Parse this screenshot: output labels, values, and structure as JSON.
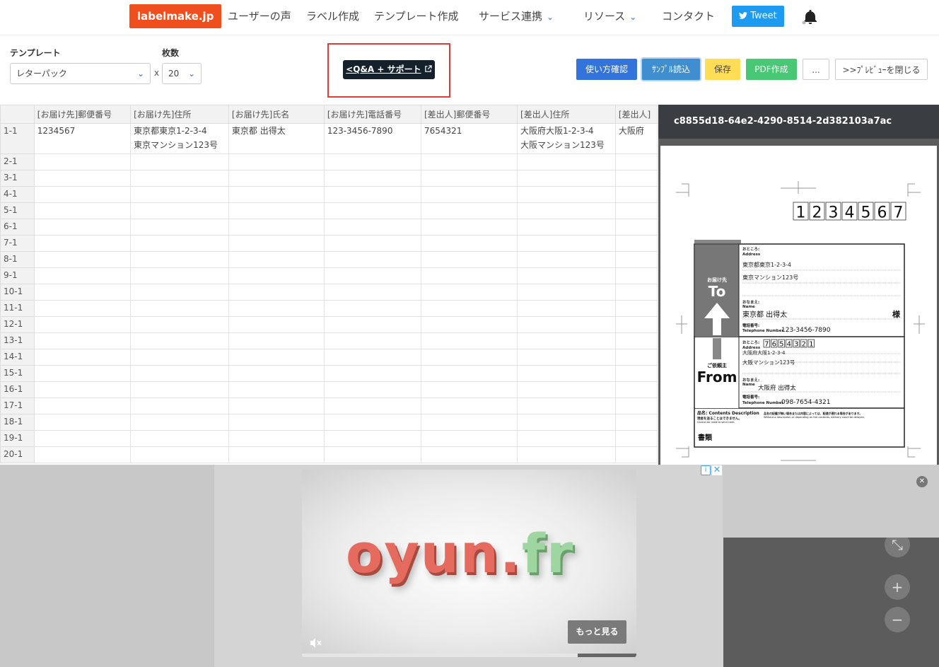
{
  "nav": {
    "logo": "labelmake.jp",
    "items": [
      "ユーザーの声",
      "ラベル作成",
      "テンプレート作成",
      "サービス連携",
      "リソース",
      "コンタクト"
    ],
    "tweet": "Tweet"
  },
  "toolbar": {
    "template_label": "テンプレート",
    "template_value": "レターパック",
    "count_label": "枚数",
    "count_value": "20",
    "x": "x",
    "qa_label": "<Q&A + サポート",
    "qa_end": ">",
    "buttons": {
      "howto": "使い方確認",
      "sample": "ｻﾝﾌﾟﾙ読込",
      "save": "保存",
      "pdf": "PDF作成",
      "more": "...",
      "close_preview": ">>ﾌﾟﾚﾋﾞｭｰを閉じる"
    },
    "colors": {
      "howto": "#3273dc",
      "sample": "#3e8ed0",
      "save": "#ffdd57",
      "pdf": "#48c774"
    }
  },
  "grid": {
    "headers": [
      "[お届け先]郵便番号",
      "[お届け先]住所",
      "[お届け先]氏名",
      "[お届け先]電話番号",
      "[差出人]郵便番号",
      "[差出人]住所",
      "[差出人]"
    ],
    "first_row": {
      "id": "1-1",
      "cells": [
        "1234567",
        "東京都東京1-2-3-4",
        "東京都 出得太",
        "123-3456-7890",
        "7654321",
        "大阪府大阪1-2-3-4",
        "大阪府"
      ],
      "cells_line2": [
        "",
        "東京マンション123号",
        "",
        "",
        "",
        "大阪マンション123号",
        ""
      ]
    },
    "row_ids": [
      "2-1",
      "3-1",
      "4-1",
      "5-1",
      "6-1",
      "7-1",
      "8-1",
      "9-1",
      "10-1",
      "11-1",
      "12-1",
      "13-1",
      "14-1",
      "15-1",
      "16-1",
      "17-1",
      "18-1",
      "19-1",
      "20-1"
    ]
  },
  "preview": {
    "title": "c8855d18-64e2-4290-8514-2d382103a7ac",
    "label": {
      "zip_to": "1234567",
      "to_small": "お届け先",
      "to_big": "To",
      "address_label": "おところ:",
      "address_en": "Address",
      "addr1": "東京都東京1-2-3-4",
      "addr2": "東京マンション123号",
      "name_label": "おなまえ:",
      "name_en": "Name",
      "name": "東京都 出得太",
      "sama": "様",
      "tel_label": "電話番号:",
      "tel_en": "Telephone Number",
      "tel": "123-3456-7890",
      "from_small": "ご依頼主",
      "from_big": "From",
      "zip_from": "7654321",
      "from_addr1": "大阪府大阪1-2-3-4",
      "from_addr2": "大阪マンション123号",
      "from_name": "大阪府 出得太",
      "from_tel": "098-7654-4321",
      "contents_label": "品名: Contents Description",
      "contents_note": "品名の記載が無い場合または内容によっては、配達が遅れる場合があります。",
      "contents_note_en": "Without a description or depending on the contents, delivery could be delayed.",
      "cash_note": "現金を送ることはできません。",
      "cash_note_en": "Cannot be used to send cash.",
      "contents": "書類"
    }
  },
  "ad": {
    "brand_main": "oyun.",
    "brand_tld": "fr",
    "more": "もっと見る"
  }
}
